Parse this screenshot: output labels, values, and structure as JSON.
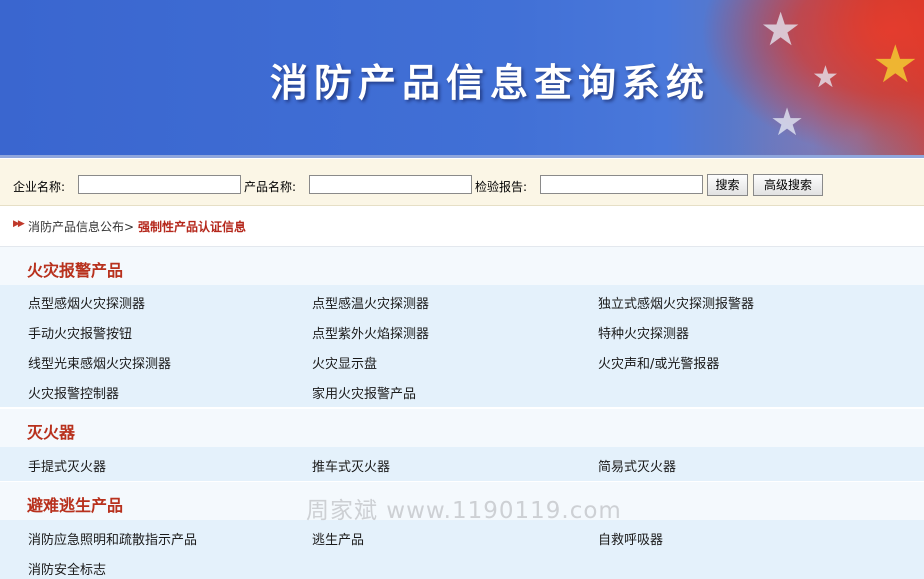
{
  "banner": {
    "title": "消防产品信息查询系统"
  },
  "search": {
    "company_label": "企业名称:",
    "company_value": "",
    "product_label": "产品名称:",
    "product_value": "",
    "report_label": "检验报告:",
    "report_value": "",
    "search_button": "搜索",
    "advanced_button": "高级搜索"
  },
  "breadcrumb": {
    "parent": "消防产品信息公布>",
    "current": "强制性产品认证信息"
  },
  "categories": [
    {
      "title": "火灾报警产品",
      "items": [
        "点型感烟火灾探测器",
        "点型感温火灾探测器",
        "独立式感烟火灾探测报警器",
        "手动火灾报警按钮",
        "点型紫外火焰探测器",
        "特种火灾探测器",
        "线型光束感烟火灾探测器",
        "火灾显示盘",
        "火灾声和/或光警报器",
        "火灾报警控制器",
        "家用火灾报警产品"
      ]
    },
    {
      "title": "灭火器",
      "items": [
        "手提式灭火器",
        "推车式灭火器",
        "简易式灭火器"
      ]
    },
    {
      "title": "避难逃生产品",
      "items": [
        "消防应急照明和疏散指示产品",
        "逃生产品",
        "自救呼吸器",
        "消防安全标志"
      ]
    }
  ],
  "watermark": "周家斌 www.1190119.com",
  "colors": {
    "banner_blue": "#3a66cf",
    "category_red": "#b8311d",
    "row_bg": "#e4f1fb"
  }
}
